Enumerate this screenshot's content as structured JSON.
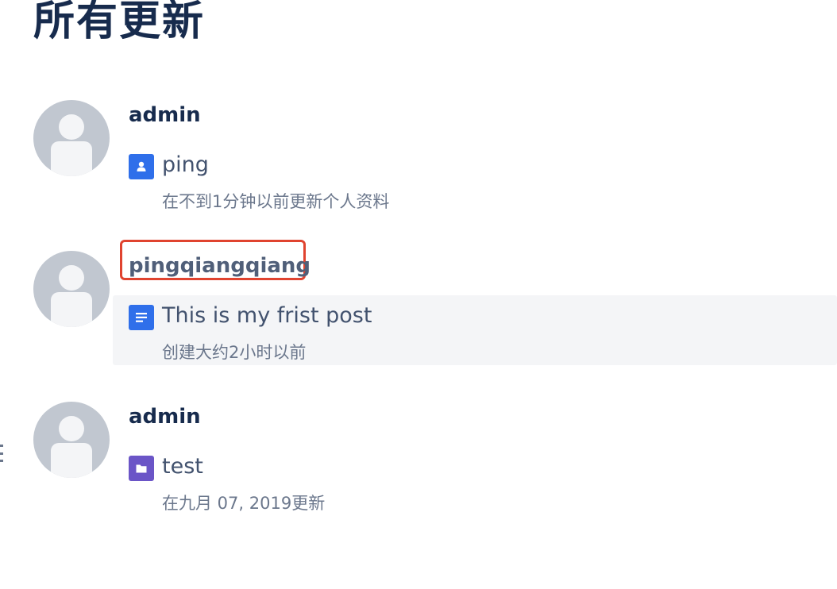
{
  "page": {
    "title": "所有更新"
  },
  "feed": [
    {
      "user": "admin",
      "icon": "user-profile-icon",
      "icon_color": "#2f6fea",
      "title": "ping",
      "meta": "在不到1分钟以前更新个人资料"
    },
    {
      "user": "pingqiangqiang",
      "icon": "page-document-icon",
      "icon_color": "#2f6fea",
      "title": "This is my frist post",
      "meta": "创建大约2小时以前",
      "highlighted": true
    },
    {
      "user": "admin",
      "icon": "folder-space-icon",
      "icon_color": "#6b55c7",
      "title": "test",
      "meta": "在九月 07, 2019更新"
    }
  ],
  "colors": {
    "heading": "#172b4d",
    "highlight_border": "#e0432f",
    "hover_background": "#f4f5f7",
    "avatar_background": "#c1c7d0"
  }
}
